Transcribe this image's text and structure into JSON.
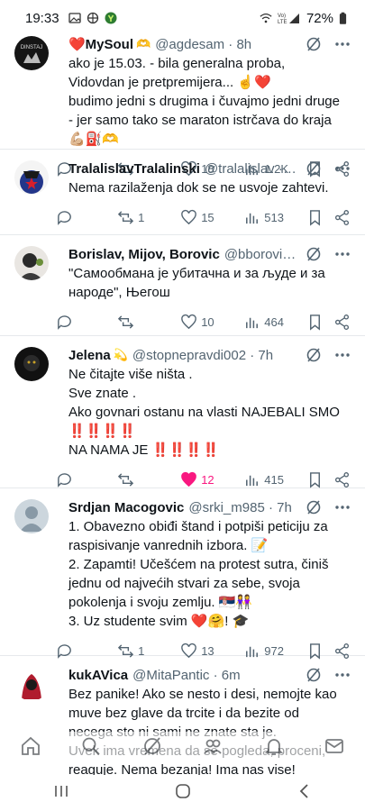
{
  "status": {
    "time": "19:33",
    "battery": "72%"
  },
  "tweets": [
    {
      "name": "❤️MySoul",
      "name_emoji": "🫶",
      "handle": "@agdesam · 8h",
      "lines": [
        "ako je 15.03. - bila generalna proba, Vidovdan je pretpremijera... ☝️❤️",
        "budimo jedni s drugima i čuvajmo jedni druge - jer samo tako se maraton istrčava do kraja 💪🏼⛽🫶"
      ],
      "replies": "",
      "retweets": "",
      "likes": "18",
      "views": "1.2K",
      "liked": false
    },
    {
      "name": "TralalislavTralalinski",
      "name_emoji": "",
      "handle": "@tralalislav · 6h",
      "lines": [
        "Nema razilaženja dok se ne usvoje zahtevi."
      ],
      "replies": "",
      "retweets": "1",
      "likes": "15",
      "views": "513",
      "liked": false
    },
    {
      "name": "Borislav, Mijov, Borovic",
      "name_emoji": "",
      "handle": "@bborovic3 · 4h",
      "lines": [
        "\"Самообмана је убитачна и за људе и за народе\", Његош"
      ],
      "replies": "",
      "retweets": "",
      "likes": "10",
      "views": "464",
      "liked": false
    },
    {
      "name": "Jelena",
      "name_emoji": "💫",
      "handle": "@stopnepravdi002 · 7h",
      "lines": [
        "Ne čitajte više ništa .",
        "Sve znate .",
        "Ako govnari ostanu na vlasti NAJEBALI SMO ‼️‼️‼️‼️",
        "NA NAMA JE ‼️‼️‼️‼️"
      ],
      "replies": "",
      "retweets": "",
      "likes": "12",
      "views": "415",
      "liked": true
    },
    {
      "name": "Srdjan Macogovic",
      "name_emoji": "",
      "handle": "@srki_m985 · 7h",
      "lines": [
        "1. Obavezno obiđi štand i potpiši peticiju za raspisivanje vanrednih izbora. 📝",
        "2. Zapamti! Učešćem na protest sutra, činiš jednu od najvećih stvari za sebe, svoja pokolenja i svoju zemlju. 🇷🇸👭",
        "3. Uz studente svim ❤️🤗! 🎓"
      ],
      "replies": "",
      "retweets": "1",
      "likes": "13",
      "views": "972",
      "liked": false
    },
    {
      "name": "kukAVica",
      "name_emoji": "",
      "handle": "@MitaPantic · 6m",
      "lines": [
        "Bez panike! Ako se nesto i desi, nemojte kao muve bez glave da trcite i da bezite od necega sto ni sami ne znate sta je.",
        "Uvek ima vremena da se pogleda, proceni, reaguje. Nema bezanja! Ima nas vise!"
      ],
      "replies": "",
      "retweets": "",
      "likes": "",
      "views": "",
      "liked": false
    }
  ]
}
